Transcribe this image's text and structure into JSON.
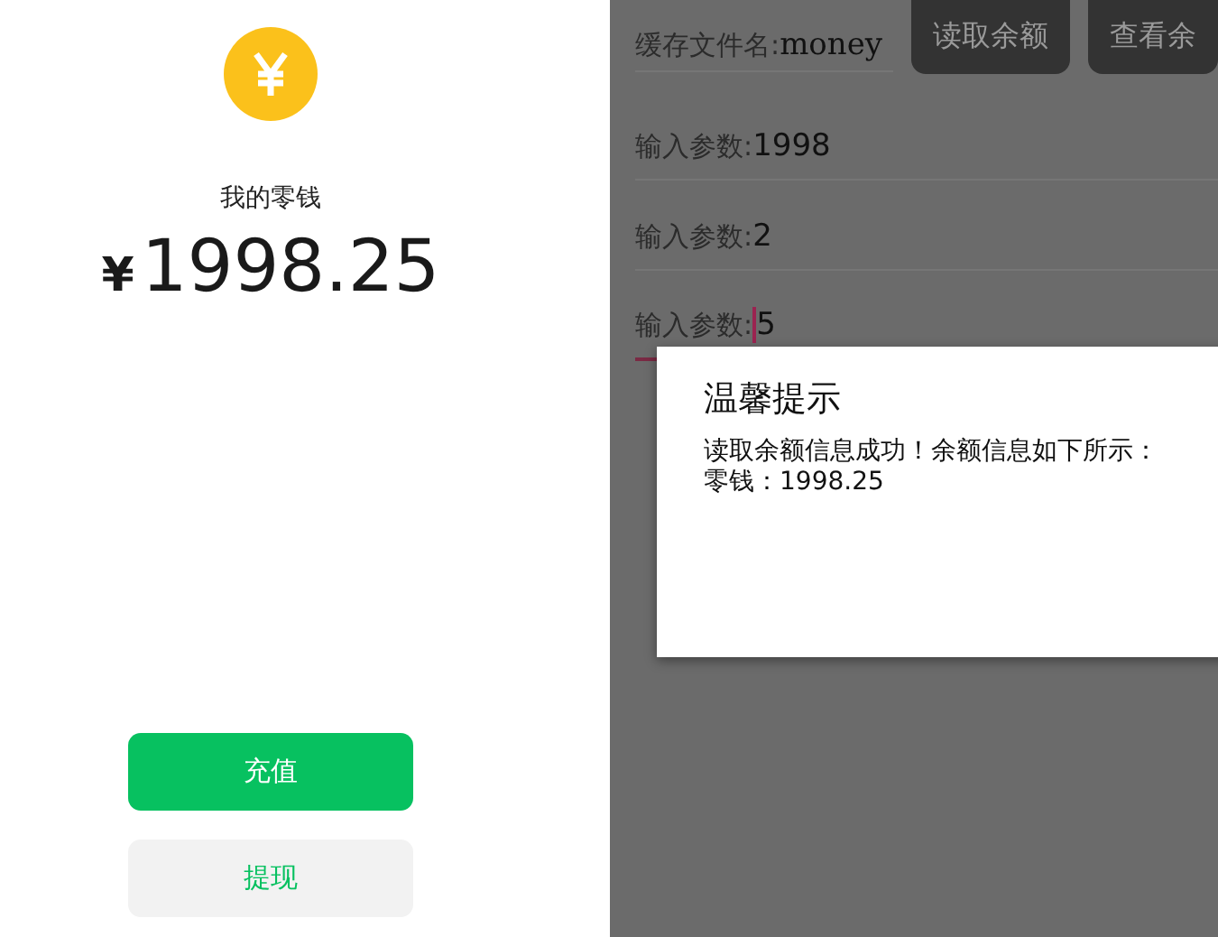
{
  "wallet": {
    "title": "我的零钱",
    "currency": "¥",
    "amount": "1998.25",
    "buttons": [
      {
        "label": "充值",
        "kind": "primary"
      },
      {
        "label": "提现",
        "kind": "secondary"
      }
    ]
  },
  "storage_form": {
    "top_field": {
      "label": "缓存文件名:",
      "value": "money"
    },
    "buttons": [
      {
        "label": "读取余额"
      },
      {
        "label": "查看余"
      }
    ],
    "fields": [
      {
        "label": "输入参数:",
        "value": "1998",
        "focused": false
      },
      {
        "label": "输入参数:",
        "value": "2",
        "focused": false
      },
      {
        "label": "输入参数:",
        "value": "5",
        "focused": true
      }
    ]
  },
  "dialog": {
    "title": "温馨提示",
    "message": "读取余额信息成功！余额信息如下所示：",
    "detail": "零钱：1998.25"
  }
}
